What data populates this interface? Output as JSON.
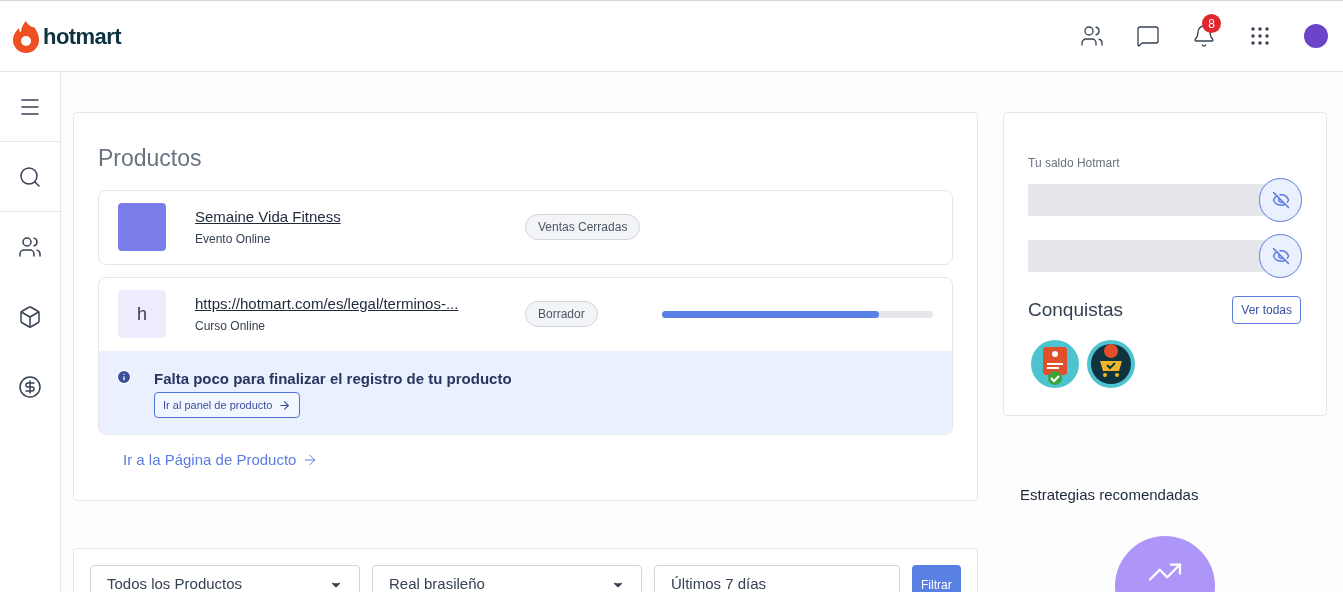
{
  "header": {
    "logo_text": "hotmart",
    "notifications_count": "8"
  },
  "sidebar": {
    "items": [
      {
        "kind": "menu"
      },
      {
        "kind": "search"
      },
      {
        "kind": "people"
      },
      {
        "kind": "box"
      },
      {
        "kind": "dollar"
      }
    ]
  },
  "products": {
    "title": "Productos",
    "items": [
      {
        "kind": "image",
        "name": "Semaine Vida Fitness",
        "type": "Evento Online",
        "status": "Ventas Cerradas"
      },
      {
        "kind": "initial",
        "initial": "h",
        "name": "https://hotmart.com/es/legal/terminos-...",
        "type": "Curso Online",
        "status": "Borrador",
        "level": 0.8,
        "notice": {
          "text": "Falta poco para finalizar el registro de tu producto",
          "button": "Ir al panel de producto"
        }
      }
    ],
    "link": "Ir a la Página de Producto"
  },
  "balance": {
    "label": "Tu saldo Hotmart",
    "fields": [
      {
        "hidden": true
      },
      {
        "hidden": true
      }
    ]
  },
  "achievements": {
    "title": "Conquistas",
    "button": "Ver todas"
  },
  "strategies": {
    "title": "Estrategias recomendadas"
  },
  "filters": {
    "product": "Todos los Productos",
    "currency": "Real brasileño",
    "period": "Últimos 7 días",
    "button": "Filtrar"
  }
}
